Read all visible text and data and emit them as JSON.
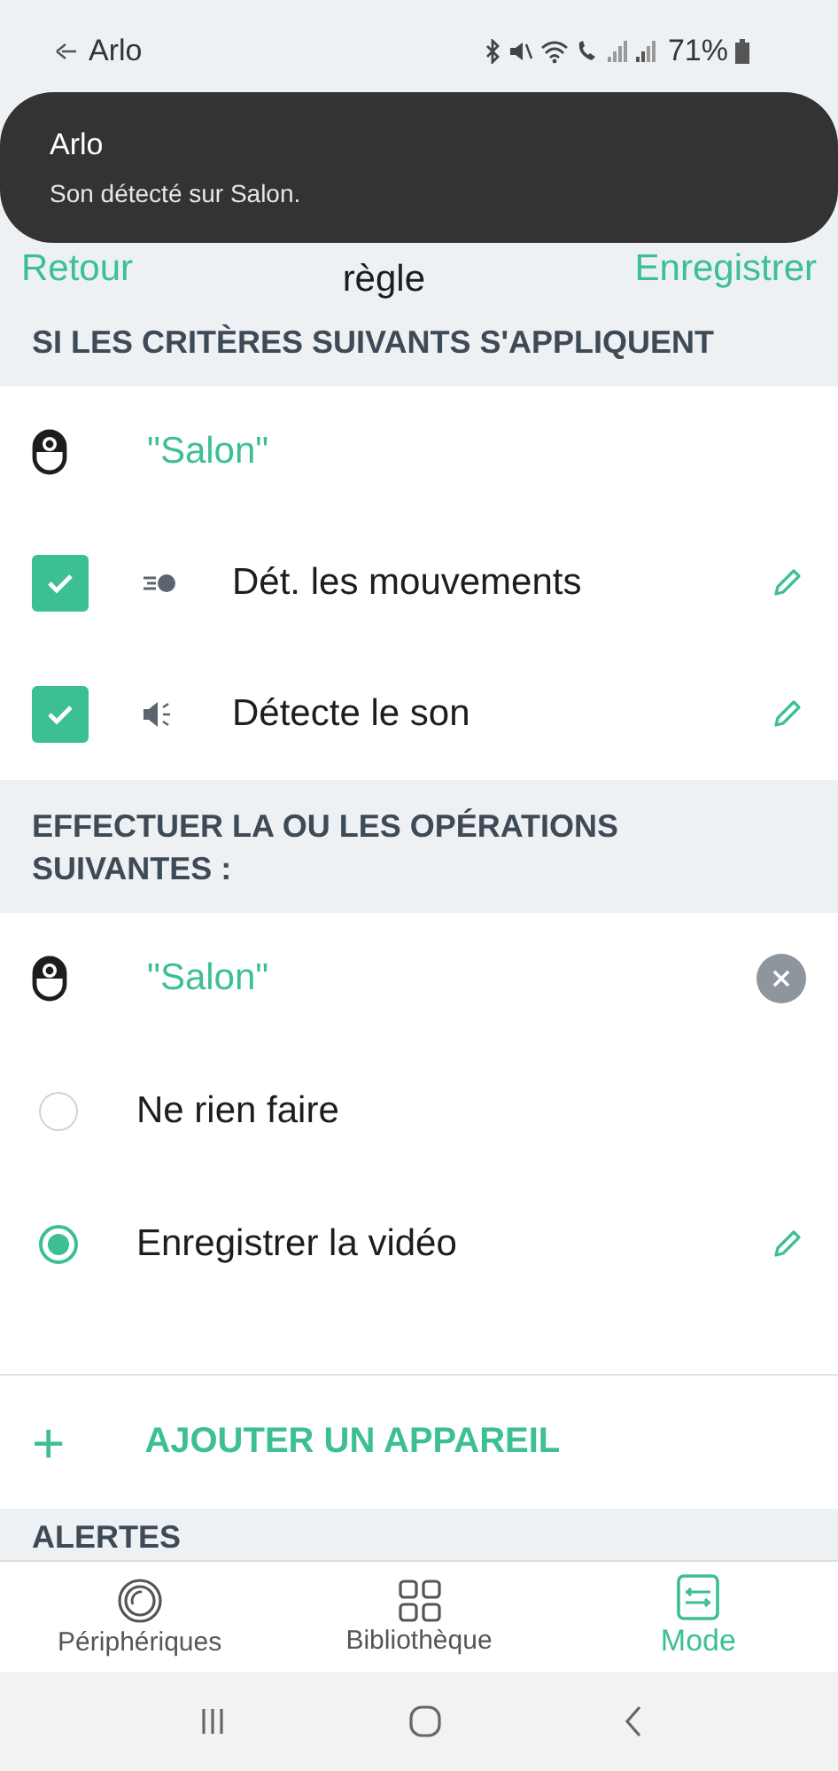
{
  "status_bar": {
    "app": "Arlo",
    "battery": "71%"
  },
  "notification": {
    "title": "Arlo",
    "message": "Son détecté sur Salon."
  },
  "header": {
    "back": "Retour",
    "title": "règle",
    "save": "Enregistrer"
  },
  "criteria": {
    "heading": "SI LES CRITÈRES SUIVANTS S'APPLIQUENT",
    "device": "\"Salon\"",
    "items": [
      {
        "kind": "motion",
        "label": "Dét. les mouvements",
        "checked": true
      },
      {
        "kind": "sound",
        "label": "Détecte le son",
        "checked": true
      }
    ]
  },
  "actions": {
    "heading": "EFFECTUER LA OU LES OPÉRATIONS SUIVANTES :",
    "device": "\"Salon\"",
    "options": [
      {
        "label": "Ne rien faire",
        "selected": false,
        "editable": false
      },
      {
        "label": "Enregistrer la vidéo",
        "selected": true,
        "editable": true
      }
    ]
  },
  "add_device": {
    "icon": "+",
    "label": "AJOUTER UN APPAREIL"
  },
  "alerts": {
    "heading": "ALERTES"
  },
  "tabs": [
    {
      "kind": "devices",
      "label": "Périphériques",
      "selected": false
    },
    {
      "kind": "library",
      "label": "Bibliothèque",
      "selected": false
    },
    {
      "kind": "mode",
      "label": "Mode",
      "selected": true
    }
  ]
}
